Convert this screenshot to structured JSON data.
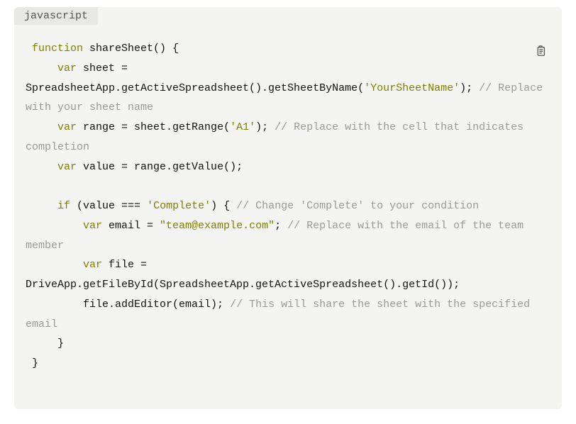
{
  "code_block": {
    "language_label": "javascript",
    "copy_icon": "clipboard-icon",
    "tokens": [
      {
        "cls": "tok-pln",
        "t": " "
      },
      {
        "cls": "tok-kw",
        "t": "function"
      },
      {
        "cls": "tok-pln",
        "t": " shareSheet() {\n     "
      },
      {
        "cls": "tok-kw",
        "t": "var"
      },
      {
        "cls": "tok-pln",
        "t": " sheet = SpreadsheetApp.getActiveSpreadsheet().getSheetByName("
      },
      {
        "cls": "tok-str",
        "t": "'YourSheetName'"
      },
      {
        "cls": "tok-pln",
        "t": "); "
      },
      {
        "cls": "tok-cmt",
        "t": "// Replace with your sheet name"
      },
      {
        "cls": "tok-pln",
        "t": "\n     "
      },
      {
        "cls": "tok-kw",
        "t": "var"
      },
      {
        "cls": "tok-pln",
        "t": " range = sheet.getRange("
      },
      {
        "cls": "tok-str",
        "t": "'A1'"
      },
      {
        "cls": "tok-pln",
        "t": "); "
      },
      {
        "cls": "tok-cmt",
        "t": "// Replace with the cell that indicates completion"
      },
      {
        "cls": "tok-pln",
        "t": "\n     "
      },
      {
        "cls": "tok-kw",
        "t": "var"
      },
      {
        "cls": "tok-pln",
        "t": " value = range.getValue();\n\n     "
      },
      {
        "cls": "tok-kw",
        "t": "if"
      },
      {
        "cls": "tok-pln",
        "t": " (value === "
      },
      {
        "cls": "tok-str",
        "t": "'Complete'"
      },
      {
        "cls": "tok-pln",
        "t": ") { "
      },
      {
        "cls": "tok-cmt",
        "t": "// Change 'Complete' to your condition"
      },
      {
        "cls": "tok-pln",
        "t": "\n         "
      },
      {
        "cls": "tok-kw",
        "t": "var"
      },
      {
        "cls": "tok-pln",
        "t": " email = "
      },
      {
        "cls": "tok-strd",
        "t": "\"team@example.com\""
      },
      {
        "cls": "tok-pln",
        "t": "; "
      },
      {
        "cls": "tok-cmt",
        "t": "// Replace with the email of the team member"
      },
      {
        "cls": "tok-pln",
        "t": "\n         "
      },
      {
        "cls": "tok-kw",
        "t": "var"
      },
      {
        "cls": "tok-pln",
        "t": " file = DriveApp.getFileById(SpreadsheetApp.getActiveSpreadsheet().getId());\n         file.addEditor(email); "
      },
      {
        "cls": "tok-cmt",
        "t": "// This will share the sheet with the specified email"
      },
      {
        "cls": "tok-pln",
        "t": "\n     }\n }"
      }
    ]
  }
}
